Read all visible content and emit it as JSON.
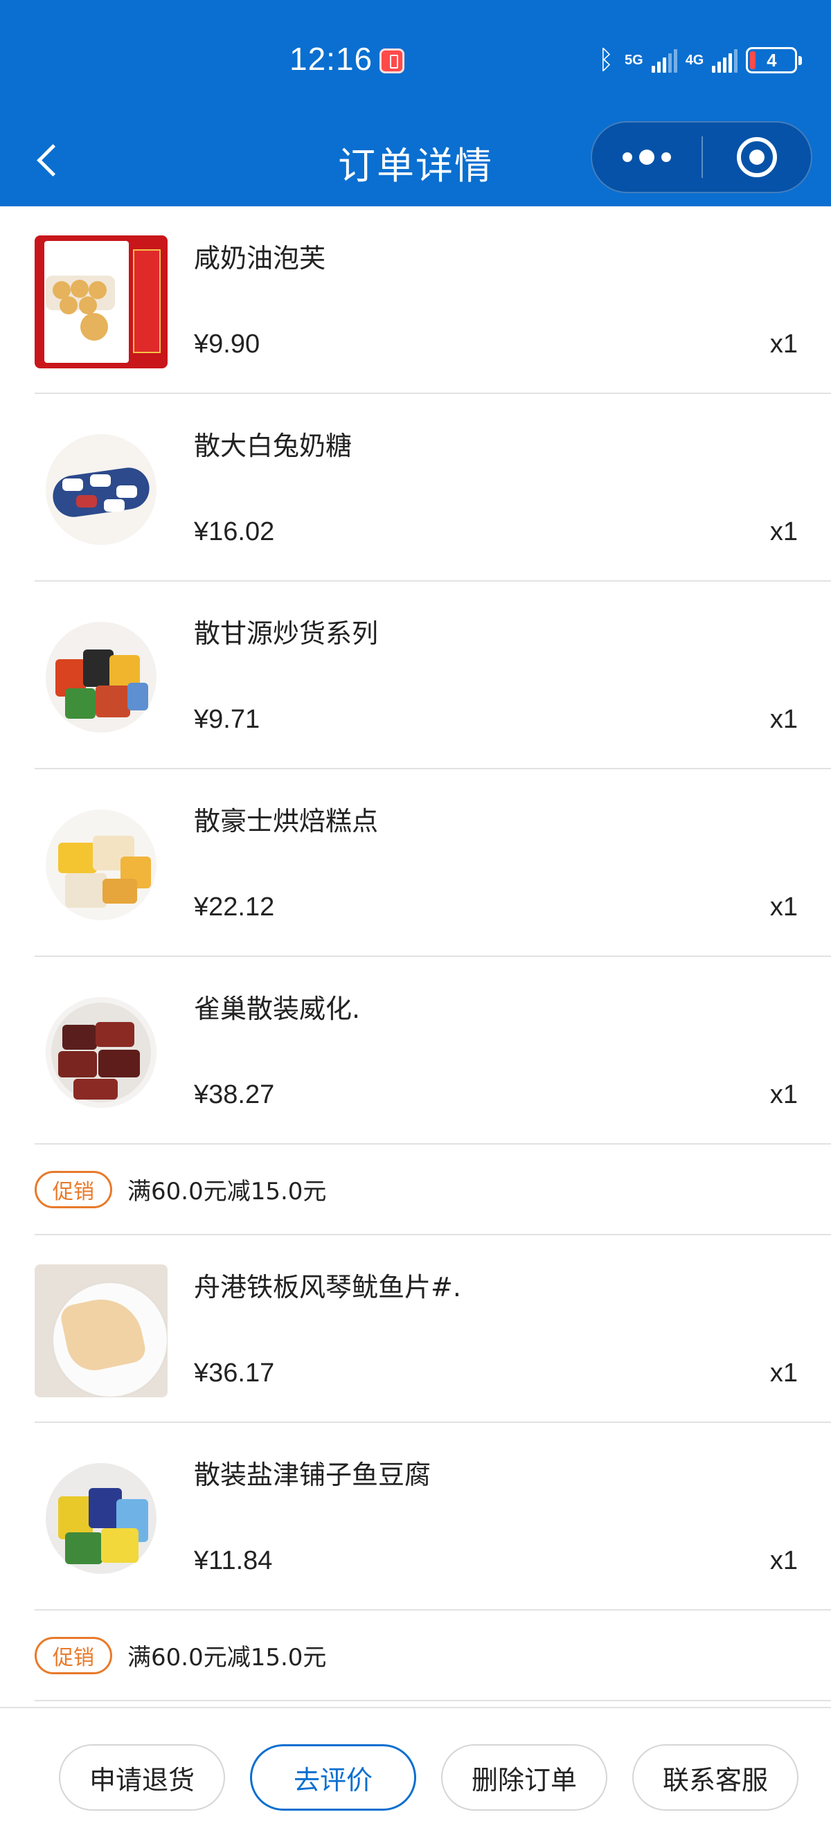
{
  "status_bar": {
    "time": "12:16",
    "network_1": "5G",
    "network_2": "4G",
    "battery": "4"
  },
  "nav": {
    "title": "订单详情"
  },
  "items": [
    {
      "name": "咸奶油泡芙",
      "price": "¥9.90",
      "qty": "x1"
    },
    {
      "name": "散大白兔奶糖",
      "price": "¥16.02",
      "qty": "x1"
    },
    {
      "name": "散甘源炒货系列",
      "price": "¥9.71",
      "qty": "x1"
    },
    {
      "name": "散豪士烘焙糕点",
      "price": "¥22.12",
      "qty": "x1"
    },
    {
      "name": "雀巢散装威化.",
      "price": "¥38.27",
      "qty": "x1"
    },
    {
      "name": "舟港铁板风琴鱿鱼片#.",
      "price": "¥36.17",
      "qty": "x1"
    },
    {
      "name": "散装盐津铺子鱼豆腐",
      "price": "¥11.84",
      "qty": "x1"
    }
  ],
  "promos": [
    {
      "tag": "促销",
      "text": "满60.0元减15.0元"
    },
    {
      "tag": "促销",
      "text": "满60.0元减15.0元"
    }
  ],
  "actions": {
    "refund": "申请退货",
    "review": "去评价",
    "delete": "删除订单",
    "support": "联系客服"
  },
  "colors": {
    "header_bg": "#0a6fd0",
    "promo_tag": "#e87a2b",
    "primary_button": "#0a6fd0"
  }
}
